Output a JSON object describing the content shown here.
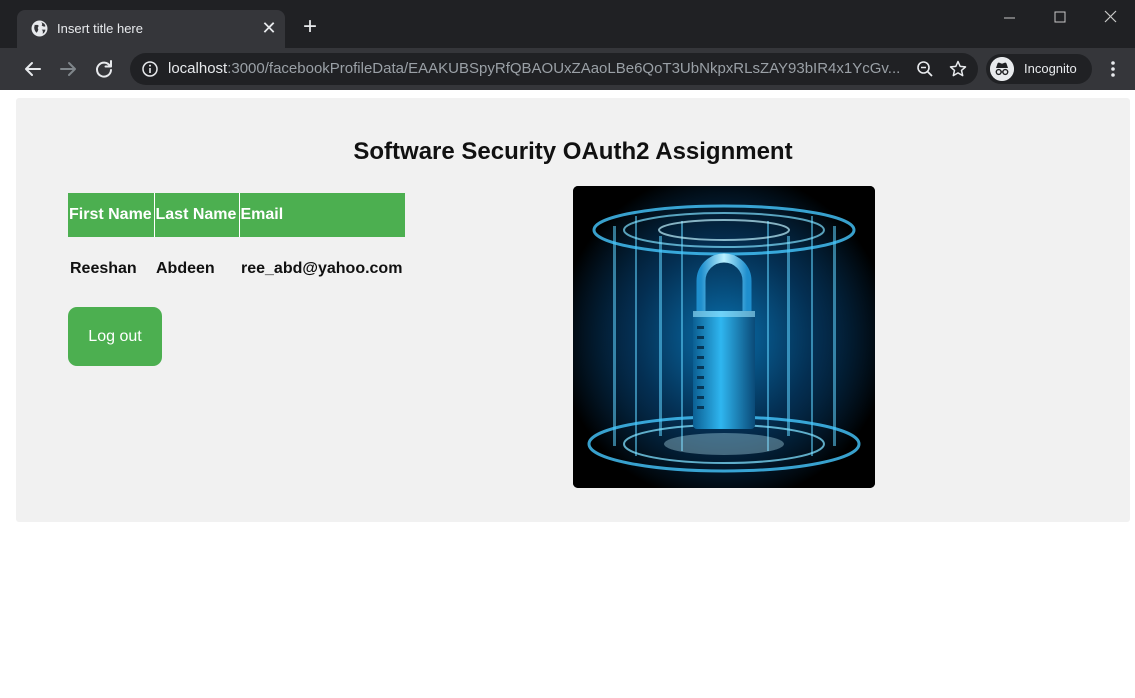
{
  "browser": {
    "tab": {
      "title": "Insert title here",
      "favicon": "globe-icon"
    },
    "url": {
      "host": "localhost",
      "rest": ":3000/facebookProfileData/EAAKUBSpyRfQBAOUxZAaoLBe6QoT3UbNkpxRLsZAY93bIR4x1YcGv..."
    },
    "incognito_label": "Incognito"
  },
  "page": {
    "title": "Software Security OAuth2 Assignment",
    "table": {
      "headers": [
        "First Name",
        "Last Name",
        "Email"
      ],
      "row": [
        "Reeshan",
        "Abdeen",
        "ree_abd@yahoo.com"
      ]
    },
    "logout_label": "Log out",
    "image": "padlock-image"
  },
  "colors": {
    "accent_green": "#4caf50",
    "panel_bg": "#f1f1f1",
    "chrome_dark": "#202124",
    "chrome_toolbar": "#35363a"
  }
}
